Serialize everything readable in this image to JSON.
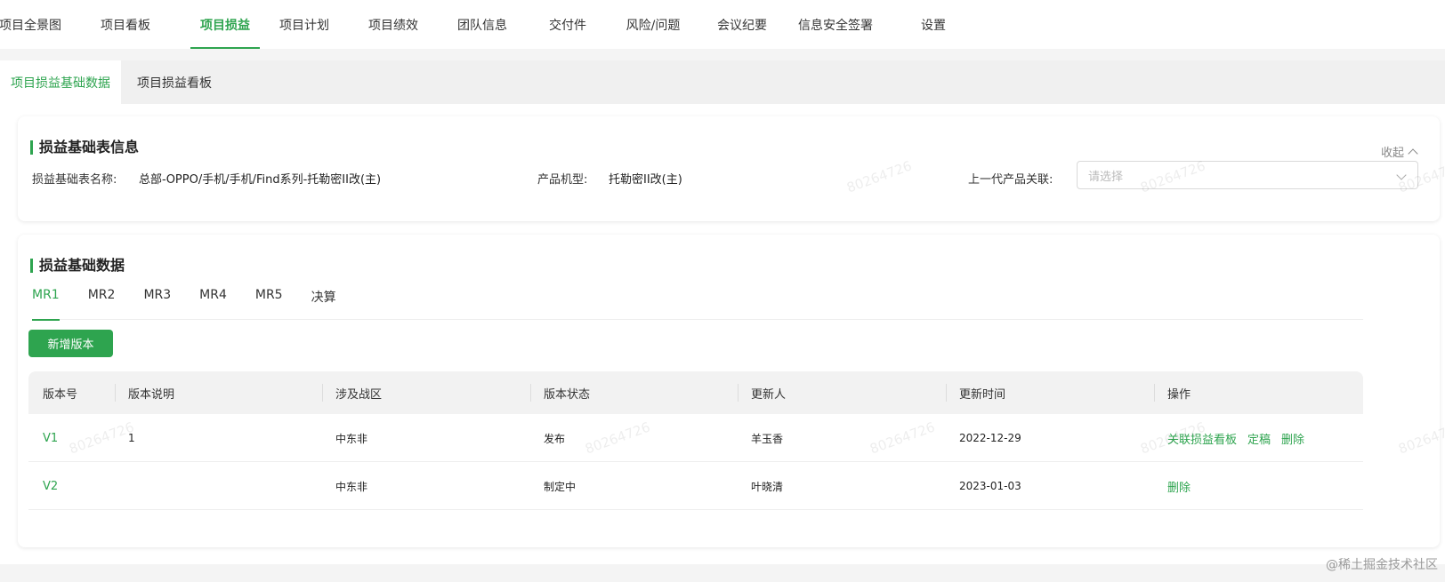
{
  "topnav": {
    "items": [
      {
        "label": "项目全景图"
      },
      {
        "label": "项目看板"
      },
      {
        "label": "项目损益",
        "active": true
      },
      {
        "label": "项目计划"
      },
      {
        "label": "项目绩效"
      },
      {
        "label": "团队信息"
      },
      {
        "label": "交付件"
      },
      {
        "label": "风险/问题"
      },
      {
        "label": "会议纪要"
      },
      {
        "label": "信息安全签署"
      },
      {
        "label": "设置"
      }
    ]
  },
  "subtabs": [
    {
      "label": "项目损益基础数据",
      "active": true
    },
    {
      "label": "项目损益看板"
    }
  ],
  "info_card": {
    "title": "损益基础表信息",
    "collapse_label": "收起",
    "name_label": "损益基础表名称:",
    "name_value": "总部-OPPO/手机/手机/Find系列-托勒密II改(主)",
    "model_label": "产品机型:",
    "model_value": "托勒密II改(主)",
    "prev_label": "上一代产品关联:",
    "prev_placeholder": "请选择"
  },
  "data_card": {
    "title": "损益基础数据",
    "tabs": [
      {
        "label": "MR1",
        "active": true
      },
      {
        "label": "MR2"
      },
      {
        "label": "MR3"
      },
      {
        "label": "MR4"
      },
      {
        "label": "MR5"
      },
      {
        "label": "决算"
      }
    ],
    "add_button": "新增版本",
    "columns": [
      "版本号",
      "版本说明",
      "涉及战区",
      "版本状态",
      "更新人",
      "更新时间",
      "操作"
    ],
    "rows": [
      {
        "version": "V1",
        "desc": "1",
        "region": "中东非",
        "status": "发布",
        "updater": "羊玉香",
        "time": "2022-12-29",
        "actions": [
          "关联损益看板",
          "定稿",
          "删除"
        ]
      },
      {
        "version": "V2",
        "desc": "",
        "region": "中东非",
        "status": "制定中",
        "updater": "叶晓清",
        "time": "2023-01-03",
        "actions": [
          "删除"
        ]
      }
    ]
  },
  "watermark_text": "80264726",
  "footer_mark": "@稀土掘金技术社区",
  "colors": {
    "accent": "#2ea44f",
    "background": "#f4f4f4"
  }
}
